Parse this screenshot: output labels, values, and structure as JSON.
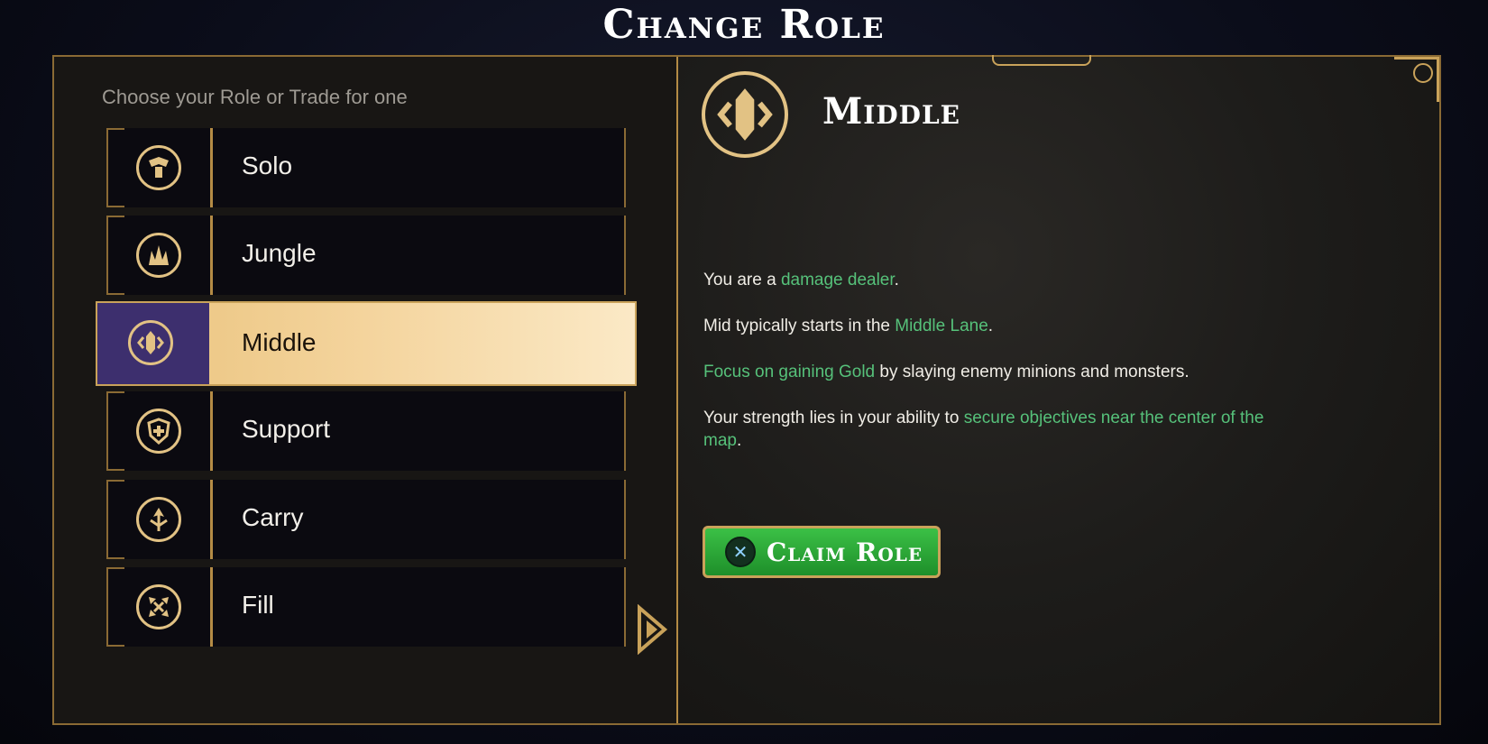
{
  "header": {
    "title": "Change Role"
  },
  "left": {
    "subtitle": "Choose your Role or Trade for one",
    "roles": [
      {
        "label": "Solo",
        "icon": "solo-icon",
        "selected": false
      },
      {
        "label": "Jungle",
        "icon": "jungle-icon",
        "selected": false
      },
      {
        "label": "Middle",
        "icon": "middle-icon",
        "selected": true
      },
      {
        "label": "Support",
        "icon": "support-icon",
        "selected": false
      },
      {
        "label": "Carry",
        "icon": "carry-icon",
        "selected": false
      },
      {
        "label": "Fill",
        "icon": "fill-icon",
        "selected": false
      }
    ]
  },
  "detail": {
    "name": "Middle",
    "icon": "middle-icon",
    "line1": {
      "pre": "You are a ",
      "hl": "damage dealer",
      "post": "."
    },
    "line2": {
      "pre": "Mid typically starts in the ",
      "hl": "Middle Lane",
      "post": "."
    },
    "line3": {
      "hl": "Focus on gaining Gold",
      "post": " by slaying enemy minions and monsters."
    },
    "line4": {
      "pre": "Your strength lies in your ability to ",
      "hl": "secure objectives near the center of the map",
      "post": "."
    }
  },
  "claim": {
    "label": "Claim Role",
    "button_glyph": "✕"
  },
  "colors": {
    "gold": "#c9a25a",
    "highlight": "#56c17a",
    "selected_purple": "#3d2f6e",
    "claim_green": "#2fa93b"
  }
}
